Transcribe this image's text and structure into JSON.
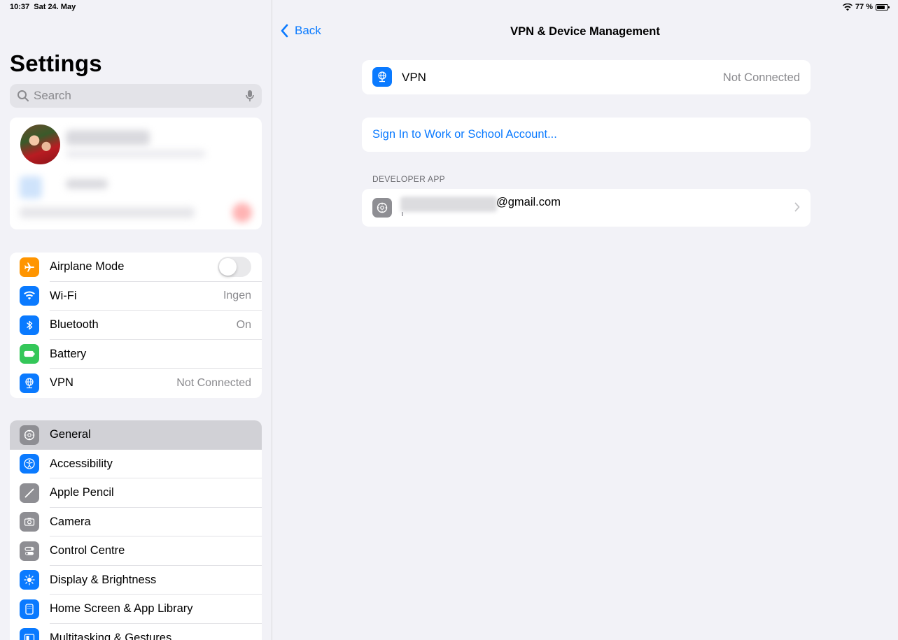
{
  "status_bar": {
    "time": "10:37",
    "date": "Sat 24. May",
    "battery": "77 %"
  },
  "sidebar": {
    "title": "Settings",
    "search_placeholder": "Search",
    "connectivity": [
      {
        "label": "Airplane Mode",
        "value": "",
        "icon": "airplane-icon",
        "color": "#ff9500"
      },
      {
        "label": "Wi-Fi",
        "value": "Ingen",
        "icon": "wifi-icon",
        "color": "#0a7aff"
      },
      {
        "label": "Bluetooth",
        "value": "On",
        "icon": "bluetooth-icon",
        "color": "#0a7aff"
      },
      {
        "label": "Battery",
        "value": "",
        "icon": "battery-icon",
        "color": "#34c759"
      },
      {
        "label": "VPN",
        "value": "Not Connected",
        "icon": "vpn-icon",
        "color": "#0a7aff"
      }
    ],
    "general_items": [
      {
        "label": "General",
        "icon": "gear-icon",
        "color": "#8e8e93",
        "selected": true
      },
      {
        "label": "Accessibility",
        "icon": "accessibility-icon",
        "color": "#0a7aff"
      },
      {
        "label": "Apple Pencil",
        "icon": "pencil-icon",
        "color": "#8e8e93"
      },
      {
        "label": "Camera",
        "icon": "camera-icon",
        "color": "#8e8e93"
      },
      {
        "label": "Control Centre",
        "icon": "control-centre-icon",
        "color": "#8e8e93"
      },
      {
        "label": "Display & Brightness",
        "icon": "brightness-icon",
        "color": "#0a7aff"
      },
      {
        "label": "Home Screen & App Library",
        "icon": "home-screen-icon",
        "color": "#0a7aff"
      },
      {
        "label": "Multitasking & Gestures",
        "icon": "multitasking-icon",
        "color": "#0a7aff"
      }
    ]
  },
  "detail": {
    "back_label": "Back",
    "title": "VPN & Device Management",
    "vpn_label": "VPN",
    "vpn_status": "Not Connected",
    "signin_label": "Sign In to Work or School Account...",
    "developer_header": "DEVELOPER APP",
    "developer_email": "@gmail.com"
  }
}
